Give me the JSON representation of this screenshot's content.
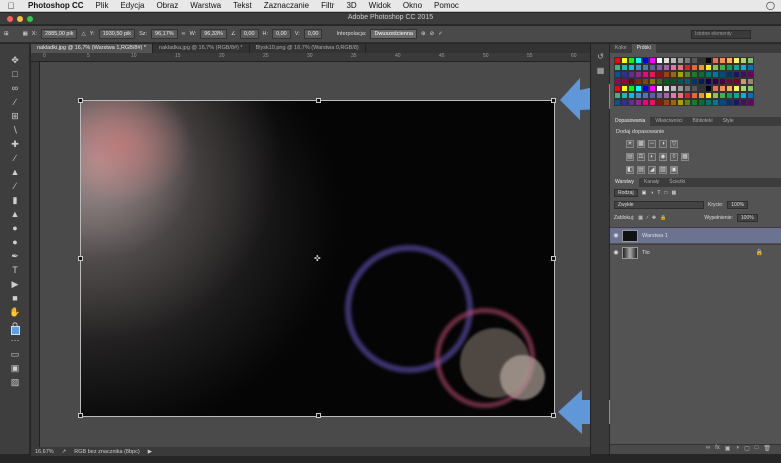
{
  "menubar": {
    "apple_icon": "apple-icon",
    "items": [
      "Photoshop CC",
      "Plik",
      "Edycja",
      "Obraz",
      "Warstwa",
      "Tekst",
      "Zaznaczanie",
      "Filtr",
      "3D",
      "Widok",
      "Okno",
      "Pomoc"
    ]
  },
  "titlebar": {
    "title": "Adobe Photoshop CC 2015"
  },
  "options": {
    "x": "2885,00 pik",
    "y": "1930,50 pik",
    "w": "96,17%",
    "h": "96,33%",
    "angle": "0,00",
    "hskew": "0,00",
    "vskew": "0,00",
    "interp_label": "Interpolacja:",
    "interp_value": "Dwusześcienna",
    "search_placeholder": "Istotne elementy"
  },
  "tabs": [
    "nakladki.jpg @ 16,7% (Warstwa 1,RGB/8#) *",
    "nakladka.jpg @ 16,7% (RGB/8#) *",
    "Blysk10.png @ 16,7% (Warstwa 0,RGB/8)"
  ],
  "ruler": [
    "0",
    "5",
    "10",
    "15",
    "20",
    "25",
    "30",
    "35",
    "40",
    "45",
    "50",
    "55",
    "60"
  ],
  "status": {
    "zoom": "16,67%",
    "profile": "RGB bez znacznika (8bpc)"
  },
  "panels": {
    "swatch_tabs": [
      "Kolor",
      "Próbki"
    ],
    "adj_tabs": [
      "Dopasowania",
      "Właściwości",
      "Biblioteki",
      "Style"
    ],
    "adj_title": "Dodaj dopasowanie",
    "layer_tabs": [
      "Warstwy",
      "Kanały",
      "Ścieżki"
    ],
    "kind": "Rodzaj",
    "blend": "Zwykłe",
    "opacity_label": "Krycie:",
    "opacity": "100%",
    "lock_label": "Zablokuj:",
    "fill_label": "Wypełnienie:",
    "fill": "100%",
    "layers": [
      {
        "name": "Warstwa 1",
        "selected": true
      },
      {
        "name": "Tło",
        "selected": false
      }
    ]
  },
  "colors": {
    "accent_arrow": "#5f97d8",
    "selected_layer": "#6b7390"
  }
}
